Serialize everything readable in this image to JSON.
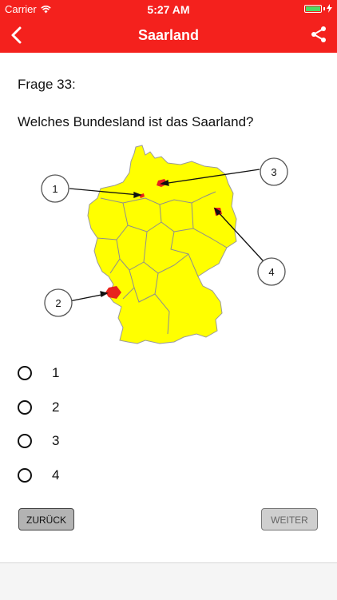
{
  "status": {
    "carrier": "Carrier",
    "time": "5:27 AM"
  },
  "nav": {
    "title": "Saarland"
  },
  "question": {
    "number_label": "Frage 33:",
    "text": "Welches Bundesland ist das Saarland?"
  },
  "map": {
    "callouts": [
      "1",
      "2",
      "3",
      "4"
    ]
  },
  "options": [
    {
      "label": "1"
    },
    {
      "label": "2"
    },
    {
      "label": "3"
    },
    {
      "label": "4"
    }
  ],
  "buttons": {
    "back": "ZURÜCK",
    "next": "WEITER"
  },
  "colors": {
    "accent": "#f4211d",
    "map_fill": "#ffff00",
    "highlight": "#e8231d"
  }
}
